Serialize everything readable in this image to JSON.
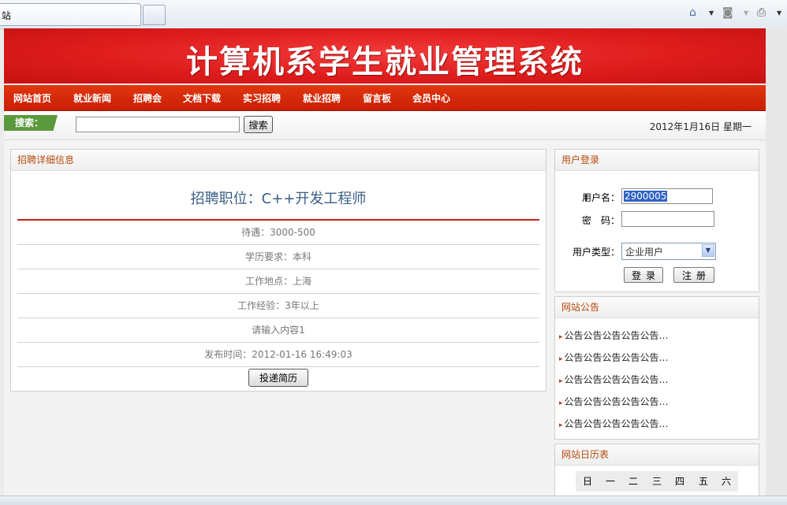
{
  "browser": {
    "tab_title": "站",
    "icons": [
      "home-icon",
      "rss-icon",
      "print-icon"
    ]
  },
  "banner": {
    "title": "计算机系学生就业管理系统"
  },
  "nav": {
    "items": [
      "网站首页",
      "就业新闻",
      "招聘会",
      "文档下载",
      "实习招聘",
      "就业招聘",
      "留言板",
      "会员中心"
    ]
  },
  "search": {
    "label": "搜索：",
    "value": "",
    "button": "搜索"
  },
  "date": "2012年1月16日 星期一",
  "detail": {
    "header": "招聘详细信息",
    "job_title": "招聘职位：C++开发工程师",
    "rows": [
      "待遇：3000-500",
      "学历要求：本科",
      "工作地点：上海",
      "工作经验：3年以上",
      "请输入内容1",
      "发布时间：2012-01-16 16:49:03"
    ],
    "apply_button": "投递简历"
  },
  "login": {
    "header": "用户登录",
    "username_label": "用户名：",
    "username_value": "2900005",
    "password_label": "密　码：",
    "usertype_label": "用户类型：",
    "usertype_value": "企业用户",
    "login_button": "登录",
    "register_button": "注册"
  },
  "notices": {
    "header": "网站公告",
    "items": [
      "公告公告公告公告公告…",
      "公告公告公告公告公告…",
      "公告公告公告公告公告…",
      "公告公告公告公告公告…",
      "公告公告公告公告公告…"
    ]
  },
  "calendar": {
    "header": "网站日历表",
    "weekdays": [
      "日",
      "一",
      "二",
      "三",
      "四",
      "五",
      "六"
    ]
  },
  "colors": {
    "banner_red": "#df1c1c",
    "nav_red": "#d42a0a",
    "panel_title": "#b84a0c",
    "search_tag_green": "#5b9a3c"
  }
}
